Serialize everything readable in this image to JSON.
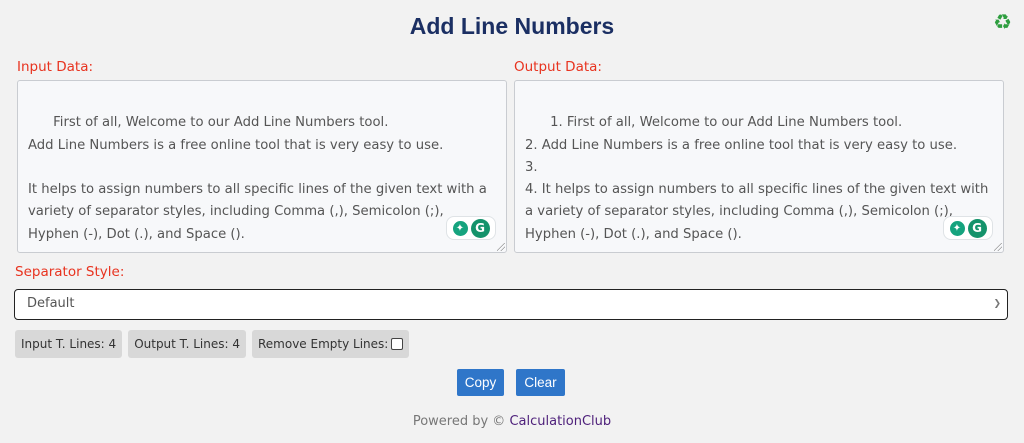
{
  "header": {
    "title": "Add Line Numbers",
    "recycle_icon": "♻"
  },
  "input": {
    "label": "Input Data:",
    "text": "First of all, Welcome to our Add Line Numbers tool.\nAdd Line Numbers is a free online tool that is very easy to use.\n\nIt helps to assign numbers to all specific lines of the given text with a variety of separator styles, including Comma (,), Semicolon (;), Hyphen (-), Dot (.), and Space ()."
  },
  "output": {
    "label": "Output Data:",
    "text": "1. First of all, Welcome to our Add Line Numbers tool.\n2. Add Line Numbers is a free online tool that is very easy to use.\n3.\n4. It helps to assign numbers to all specific lines of the given text with a variety of separator styles, including Comma (,), Semicolon (;), Hyphen (-), Dot (.), and Space ()."
  },
  "separator": {
    "label": "Separator Style:",
    "selected": "Default"
  },
  "stats": {
    "input_lines": "Input T. Lines: 4",
    "output_lines": "Output T. Lines: 4",
    "remove_empty": "Remove Empty Lines:"
  },
  "buttons": {
    "copy": "Copy",
    "clear": "Clear"
  },
  "footer": {
    "powered_by": "Powered by ©",
    "brand": "CalculationClub"
  },
  "colors": {
    "title": "#1b2f63",
    "label": "#e8331f",
    "button": "#2f76c9",
    "brand": "#4d1f7a"
  }
}
